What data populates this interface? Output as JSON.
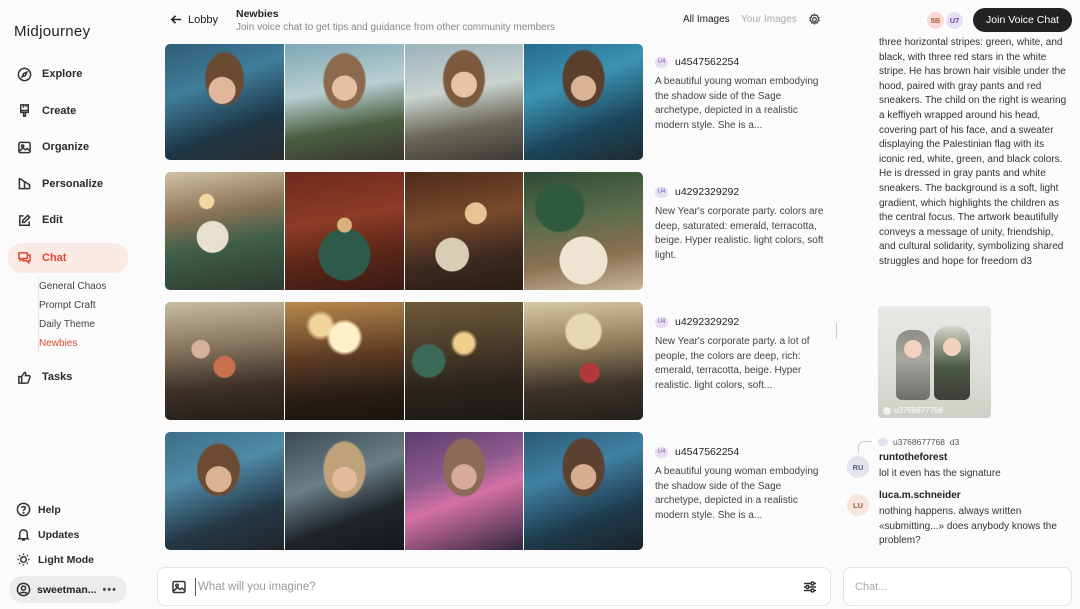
{
  "app": {
    "title": "Midjourney"
  },
  "sidebar": {
    "items": [
      {
        "label": "Explore",
        "icon": "compass-icon"
      },
      {
        "label": "Create",
        "icon": "brush-icon"
      },
      {
        "label": "Organize",
        "icon": "image-icon"
      },
      {
        "label": "Personalize",
        "icon": "personalize-icon"
      },
      {
        "label": "Edit",
        "icon": "edit-icon"
      },
      {
        "label": "Chat",
        "icon": "chat-icon",
        "active": true
      },
      {
        "label": "Tasks",
        "icon": "thumbs-up-icon"
      }
    ],
    "chat_rooms": [
      "General Chaos",
      "Prompt Craft",
      "Daily Theme",
      "Newbies"
    ],
    "active_room": "Newbies",
    "bottom": [
      {
        "label": "Help",
        "icon": "help-icon"
      },
      {
        "label": "Updates",
        "icon": "bell-icon"
      },
      {
        "label": "Light Mode",
        "icon": "sun-icon"
      }
    ],
    "user": {
      "name": "sweetman...",
      "menu": "•••"
    }
  },
  "header": {
    "back_label": "Lobby",
    "channel_title": "Newbies",
    "channel_subtitle": "Join voice chat to get tips and guidance from other community members",
    "tab_all": "All Images",
    "tab_yours": "Your Images",
    "avatars": [
      "5B",
      "U7"
    ],
    "join_button": "Join Voice Chat"
  },
  "feed": {
    "posts": [
      {
        "badge": "U4",
        "user": "u4547562254",
        "prompt": "A beautiful young woman embodying the shadow side of the Sage archetype, depicted in a realistic modern style. She is a..."
      },
      {
        "badge": "U4",
        "user": "u4292329292",
        "prompt": "New Year's corporate party. colors are deep, saturated: emerald, terracotta, beige. Hyper realistic. light colors, soft light."
      },
      {
        "badge": "U4",
        "user": "u4292329292",
        "prompt": "New Year's corporate party. a lot of people, the colors are deep, rich: emerald, terracotta, beige. Hyper realistic. light colors, soft..."
      },
      {
        "badge": "U4",
        "user": "u4547562254",
        "prompt": "A beautiful young woman embodying the shadow side of the Sage archetype, depicted in a realistic modern style. She is a..."
      }
    ]
  },
  "chat": {
    "top_text": "three horizontal stripes: green, white, and black, with three red stars in the white stripe. He has brown hair visible under the hood, paired with gray pants and red sneakers. The child on the right is wearing a keffiyeh wrapped around his head, covering part of his face, and a sweater displaying the Palestinian flag with its iconic red, white, green, and black colors. He is dressed in gray pants and white sneakers. The background is a soft, light gradient, which highlights the children as the central focus. The artwork beautifully conveys a message of unity, friendship, and cultural solidarity, symbolizing shared struggles and hope for freedom d3",
    "image_caption": "u3768677768",
    "reply_ref": "u3768677768",
    "reply_ref_tag": "d3",
    "messages": [
      {
        "initials": "RU",
        "name": "runtotheforest",
        "text": "lol it even has the signature",
        "avatar_bg": "#e3e4ee",
        "avatar_fg": "#5a5f7d"
      },
      {
        "initials": "LU",
        "name": "luca.m.schneider",
        "text": "nothing happens. always written «submitting...» does anybody knows the problem?",
        "avatar_bg": "#f6e6dc",
        "avatar_fg": "#9a5e3d"
      }
    ]
  },
  "composer": {
    "prompt_placeholder": "What will you imagine?",
    "chat_placeholder": "Chat..."
  },
  "colors": {
    "accent": "#e0482c",
    "active_bg": "#fbe9e6",
    "button_dark": "#222222"
  }
}
